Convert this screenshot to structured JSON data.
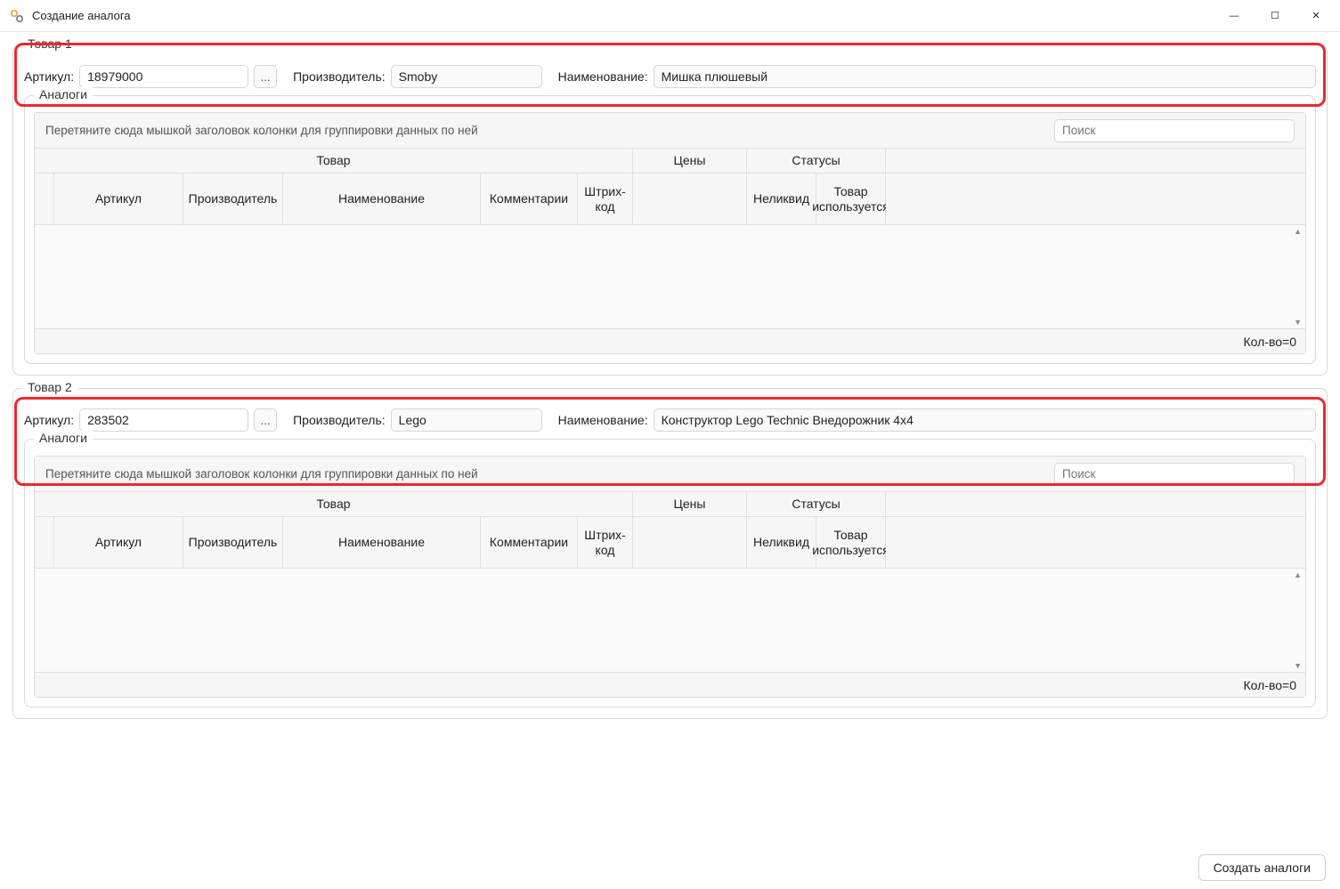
{
  "window": {
    "title": "Создание аналога"
  },
  "labels": {
    "article": "Артикул:",
    "manufacturer": "Производитель:",
    "name": "Наименование:",
    "analogs": "Аналоги"
  },
  "product1": {
    "legend": "Товар 1",
    "article": "18979000",
    "manufacturer": "Smoby",
    "name": "Мишка плюшевый"
  },
  "product2": {
    "legend": "Товар 2",
    "article": "283502",
    "manufacturer": "Lego",
    "name": "Конструктор Lego Technic Внедорожник 4х4"
  },
  "grid": {
    "group_hint": "Перетяните сюда мышкой заголовок колонки для группировки данных по ней",
    "search_placeholder": "Поиск",
    "bands": {
      "tovar": "Товар",
      "prices": "Цены",
      "status": "Статусы"
    },
    "cols": {
      "article": "Артикул",
      "manufacturer": "Производитель",
      "name": "Наименование",
      "comment": "Комментарии",
      "barcode": "Штрих-код",
      "illiquid": "Неликвид",
      "used": "Товар используется"
    },
    "count_label": "Кол-во=0"
  },
  "actions": {
    "create": "Создать аналоги",
    "lookup": "..."
  }
}
